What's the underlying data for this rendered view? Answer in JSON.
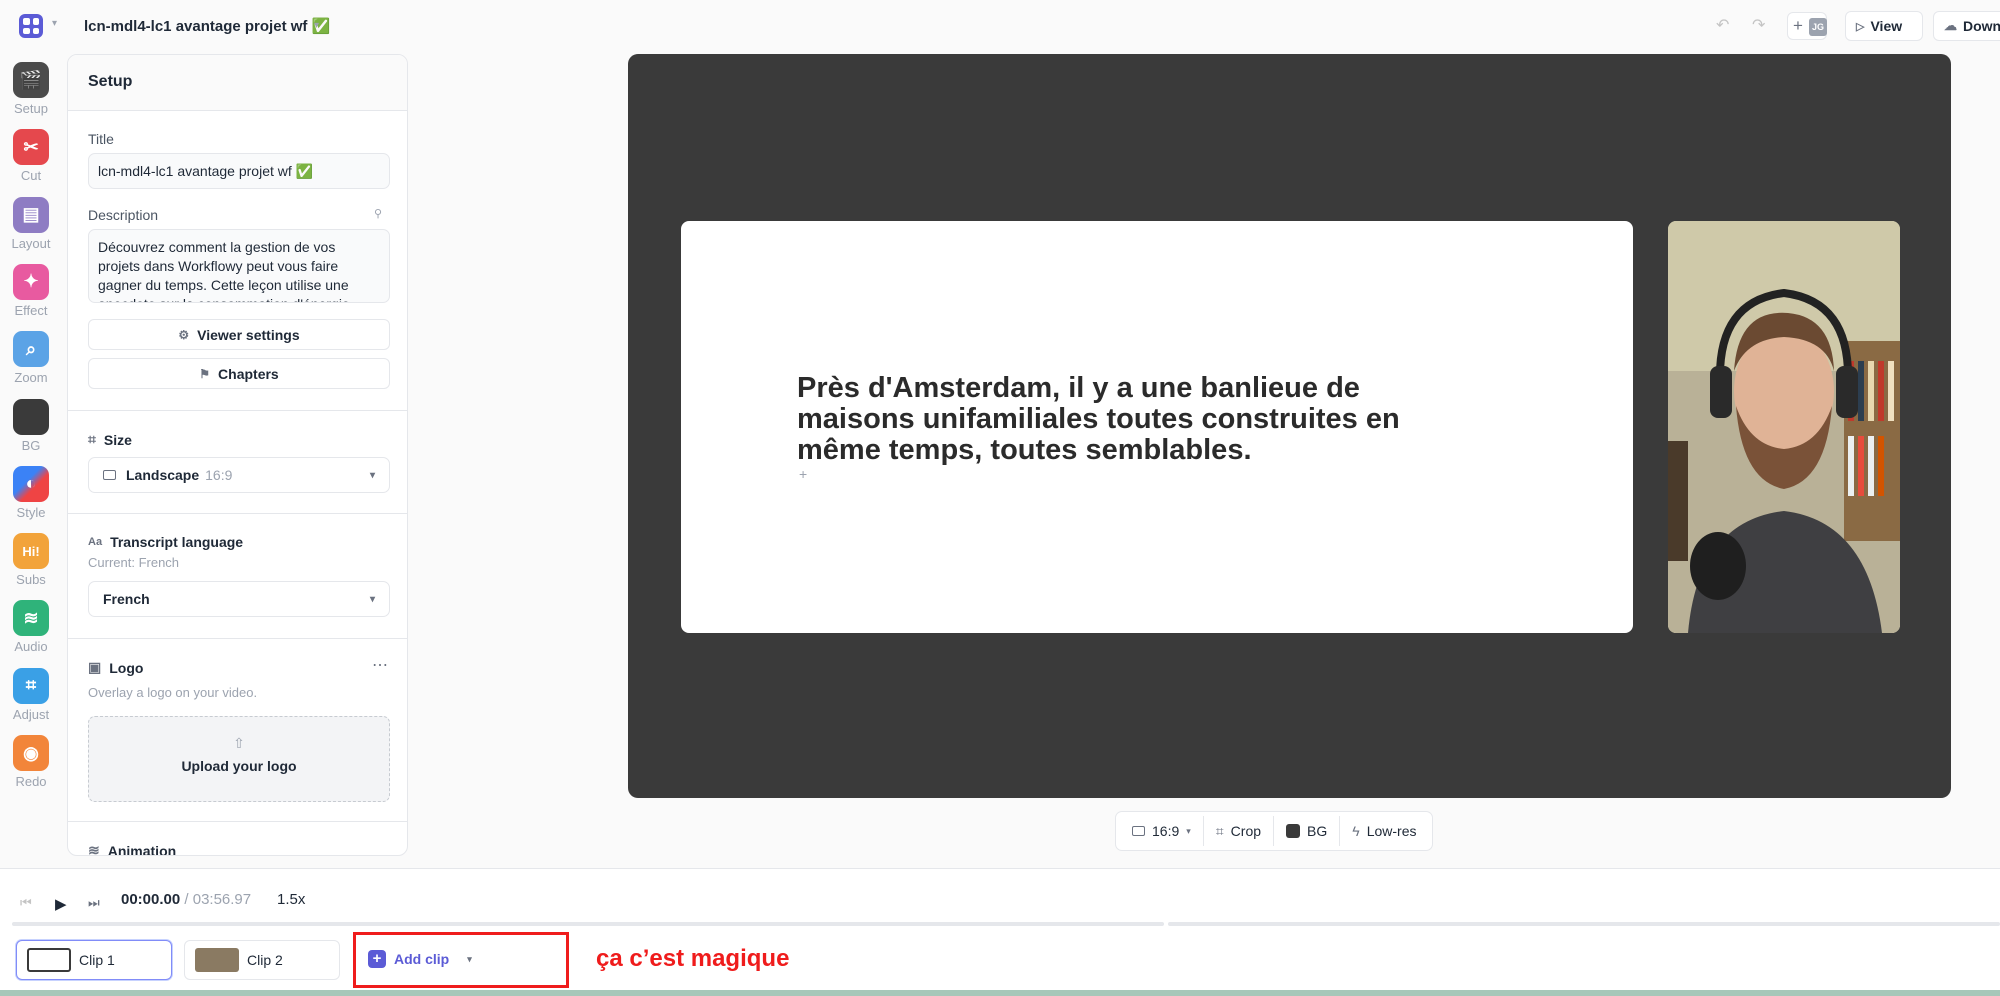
{
  "topbar": {
    "project_title": "lcn-mdl4-lc1 avantage projet wf ✅",
    "collaborator_initials": "JG",
    "view_label": "View",
    "download_label": "Down"
  },
  "rail": [
    {
      "label": "Setup",
      "icon": "clapper-icon",
      "color": "#4b4b4b"
    },
    {
      "label": "Cut",
      "icon": "scissors-icon",
      "color": "#e5484d"
    },
    {
      "label": "Layout",
      "icon": "layout-icon",
      "color": "#8e7cc3"
    },
    {
      "label": "Effect",
      "icon": "magic-wand-icon",
      "color": "#e85aa0"
    },
    {
      "label": "Zoom",
      "icon": "magnifier-icon",
      "color": "#5ba3e6"
    },
    {
      "label": "BG",
      "icon": "background-icon",
      "color": "#3a3a3a"
    },
    {
      "label": "Style",
      "icon": "style-icon",
      "color": "#f1f1f1"
    },
    {
      "label": "Subs",
      "icon": "subtitles-icon",
      "color": "#f2a33a"
    },
    {
      "label": "Audio",
      "icon": "waveform-icon",
      "color": "#2fb37a"
    },
    {
      "label": "Adjust",
      "icon": "crop-icon",
      "color": "#3aa0e6"
    },
    {
      "label": "Redo",
      "icon": "camera-icon",
      "color": "#f2853a"
    }
  ],
  "panel": {
    "heading": "Setup",
    "title_label": "Title",
    "title_value": "lcn-mdl4-lc1 avantage projet wf ✅",
    "description_label": "Description",
    "description_value": "Découvrez comment la gestion de vos projets dans Workflowy peut vous faire gagner du temps. Cette leçon utilise une anecdote sur la consommation d'énergie",
    "viewer_settings_label": "Viewer settings",
    "chapters_label": "Chapters",
    "size_label": "Size",
    "size_value": "Landscape",
    "size_ratio": "16:9",
    "transcript_label": "Transcript language",
    "transcript_current": "Current: French",
    "transcript_value": "French",
    "logo_label": "Logo",
    "logo_sub": "Overlay a logo on your video.",
    "upload_label": "Upload your logo",
    "animation_label": "Animation"
  },
  "stage": {
    "slide_text": "Près d'Amsterdam, il y a une banlieue de maisons unifamiliales toutes construites en même temps, toutes semblables."
  },
  "toolbar": {
    "ratio": "16:9",
    "crop": "Crop",
    "bg": "BG",
    "lowres": "Low-res"
  },
  "timeline": {
    "current_time": "00:00.00",
    "total_time": "/ 03:56.97",
    "speed": "1.5x",
    "clips": [
      "Clip 1",
      "Clip 2"
    ],
    "add_clip": "Add clip",
    "annotation": "ça c’est magique"
  }
}
